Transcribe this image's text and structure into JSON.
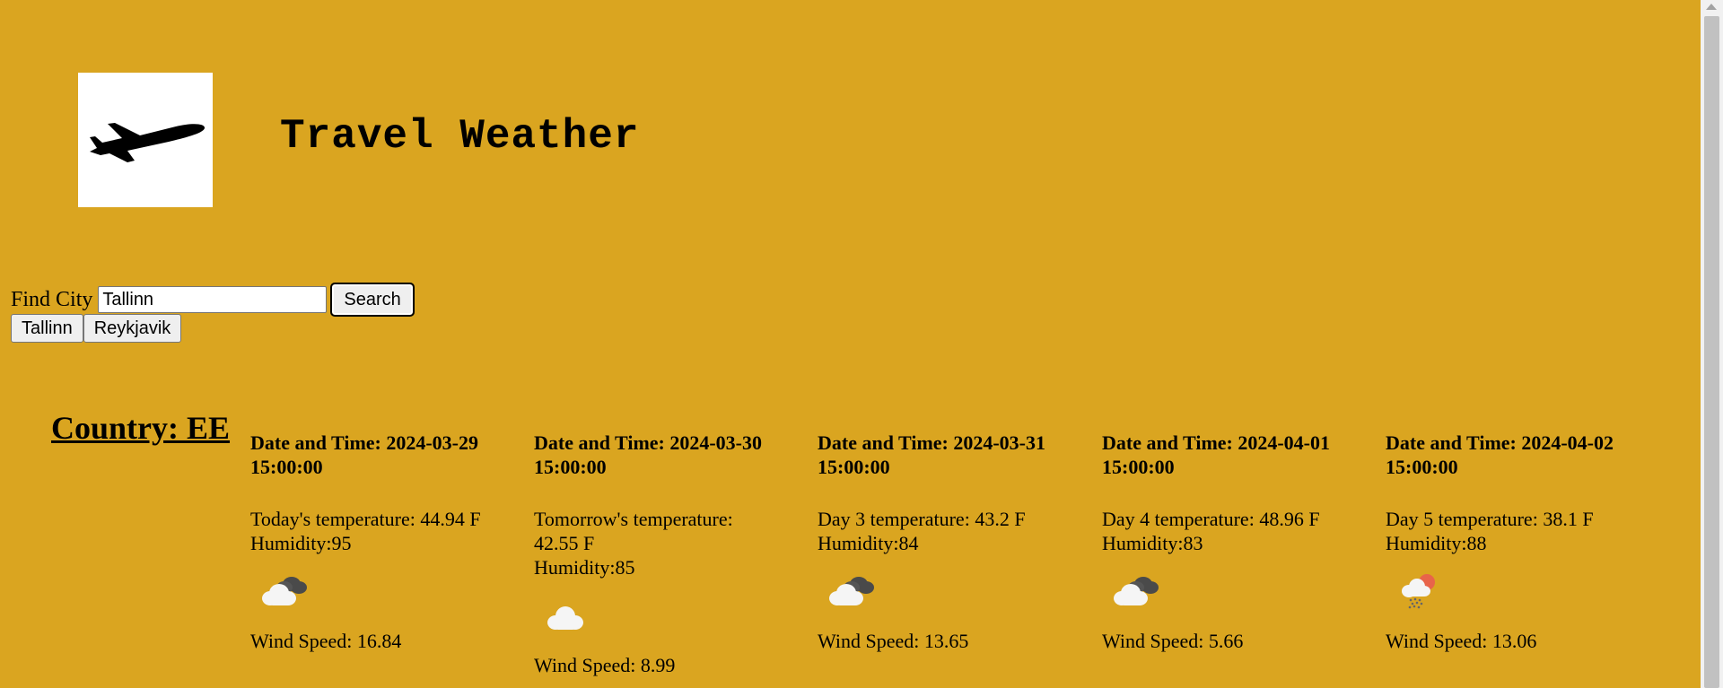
{
  "header": {
    "title": "Travel Weather",
    "logo_icon": "airplane-icon"
  },
  "search": {
    "label": "Find City",
    "value": "Tallinn",
    "button_label": "Search"
  },
  "recent_cities": [
    {
      "label": "Tallinn"
    },
    {
      "label": "Reykjavik"
    }
  ],
  "country": {
    "text": "Country: EE"
  },
  "forecast": [
    {
      "datetime": "Date and Time: 2024-03-29 15:00:00",
      "temperature": "Today's temperature: 44.94 F",
      "humidity": "Humidity:95",
      "icon": "dark-clouds-icon",
      "wind": "Wind Speed: 16.84"
    },
    {
      "datetime": "Date and Time: 2024-03-30 15:00:00",
      "temperature": "Tomorrow's temperature: 42.55 F",
      "humidity": "Humidity:85",
      "icon": "cloud-icon",
      "wind": "Wind Speed: 8.99"
    },
    {
      "datetime": "Date and Time: 2024-03-31 15:00:00",
      "temperature": "Day 3 temperature: 43.2 F",
      "humidity": "Humidity:84",
      "icon": "dark-clouds-icon",
      "wind": "Wind Speed: 13.65"
    },
    {
      "datetime": "Date and Time: 2024-04-01 15:00:00",
      "temperature": "Day 4 temperature: 48.96 F",
      "humidity": "Humidity:83",
      "icon": "dark-clouds-icon",
      "wind": "Wind Speed: 5.66"
    },
    {
      "datetime": "Date and Time: 2024-04-02 15:00:00",
      "temperature": "Day 5 temperature: 38.1 F",
      "humidity": "Humidity:88",
      "icon": "rain-sun-icon",
      "wind": "Wind Speed: 13.06"
    }
  ],
  "colors": {
    "background": "#DAA520",
    "logo_bg": "#FFFFFF"
  }
}
